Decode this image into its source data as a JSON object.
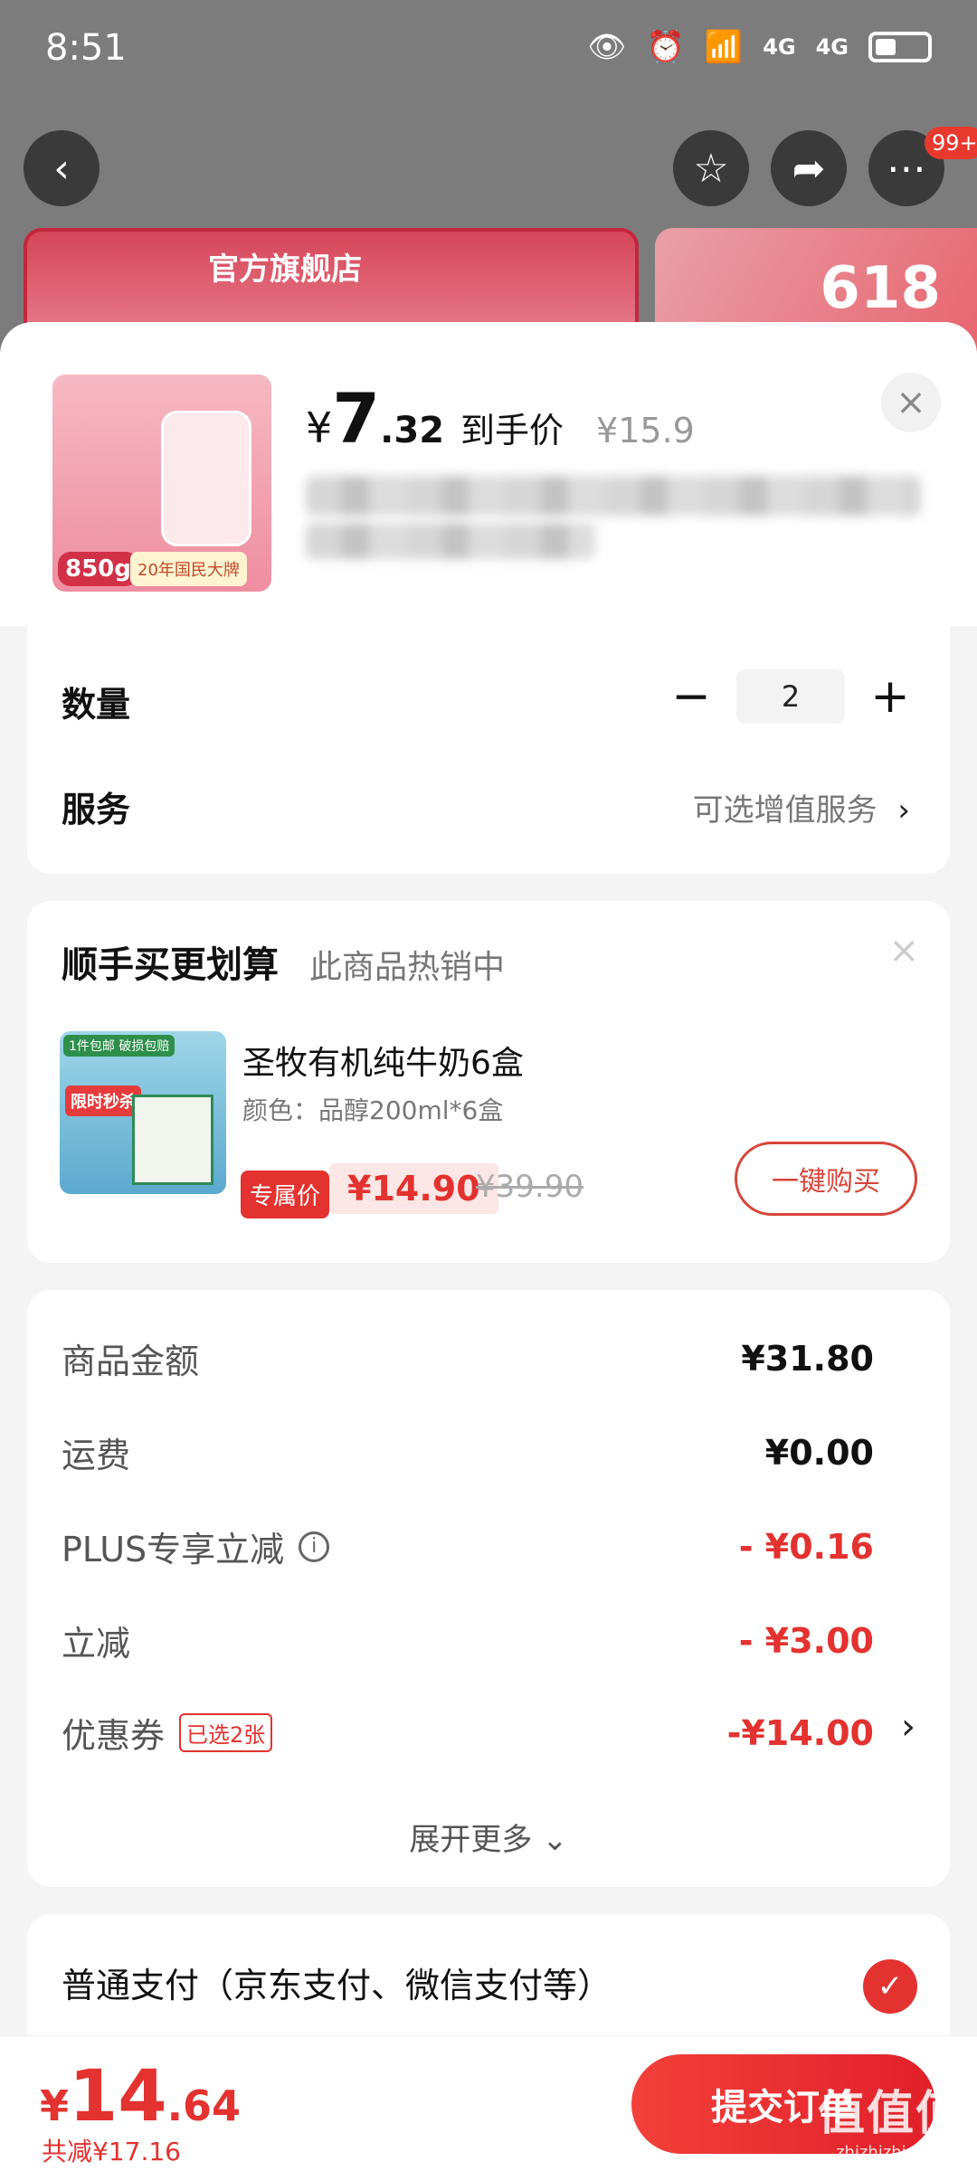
{
  "status_bar": {
    "time": "8:51",
    "signal_1": "4G",
    "signal_2": "4G"
  },
  "background": {
    "store_name": "官方旗舰店",
    "promo_618": "618",
    "more_badge": "99+"
  },
  "product": {
    "price_symbol": "¥",
    "price_int": "7",
    "price_dec": ".32",
    "price_label": "到手价",
    "original_price": "¥15.9",
    "thumb_weight": "850g",
    "thumb_slogan": "20年国民大牌"
  },
  "quantity": {
    "label": "数量",
    "value": "2",
    "minus": "−",
    "plus": "+"
  },
  "service": {
    "label": "服务",
    "value": "可选增值服务"
  },
  "upsell": {
    "title": "顺手买更划算",
    "subtitle": "此商品热销中",
    "item_name": "圣牧有机纯牛奶6盒",
    "item_spec": "颜色：品醇200ml*6盒",
    "price_tag": "专属价",
    "price": "¥14.90",
    "original_price": "¥39.90",
    "buy_label": "一键购买",
    "thumb_tag1": "1件包邮 破损包赔",
    "thumb_tag2": "限时秒杀"
  },
  "summary": {
    "rows": [
      {
        "label": "商品金额",
        "value": "¥31.80"
      },
      {
        "label": "运费",
        "value": "¥0.00"
      },
      {
        "label": "PLUS专享立减",
        "value": "- ¥0.16"
      },
      {
        "label": "立减",
        "value": "- ¥3.00"
      },
      {
        "label": "优惠券",
        "badge": "已选2张",
        "value": "-¥14.00"
      }
    ],
    "expand_label": "展开更多"
  },
  "payment": {
    "label": "普通支付（京东支付、微信支付等）"
  },
  "bottom": {
    "total_symbol": "¥",
    "total_int": "14",
    "total_dec": ".64",
    "saved": "共减¥17.16",
    "submit_label": "提交订单",
    "watermark": "值值值",
    "watermark_url": "zhizhizhi.com"
  },
  "colors": {
    "accent": "#e3322f"
  }
}
